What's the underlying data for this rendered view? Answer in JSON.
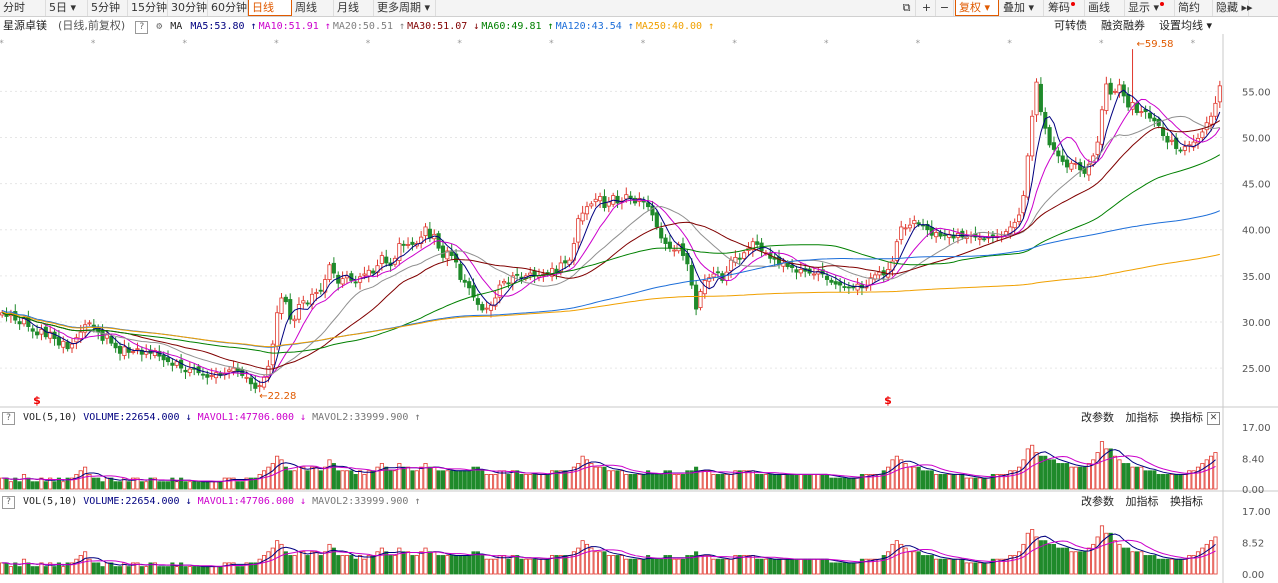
{
  "toolbar": {
    "items": [
      "分时",
      "5日",
      "5分钟",
      "15分钟",
      "30分钟",
      "60分钟",
      "日线",
      "周线",
      "月线",
      "更多周期"
    ],
    "right_items": [
      "复权",
      "叠加",
      "筹码",
      "画线",
      "显示",
      "简约",
      "隐藏"
    ]
  },
  "ma_line": {
    "stock_name": "星源卓镁",
    "mode": "(日线,前复权)",
    "ma_label": "MA",
    "items": [
      {
        "text": "MA5:53.80",
        "arrow": "↑",
        "color": "#000080"
      },
      {
        "text": "MA10:51.91",
        "arrow": "↑",
        "color": "#cc00cc"
      },
      {
        "text": "MA20:50.51",
        "arrow": "↑",
        "color": "#808080"
      },
      {
        "text": "MA30:51.07",
        "arrow": "↓",
        "color": "#800000"
      },
      {
        "text": "MA60:49.81",
        "arrow": "↑",
        "color": "#008000"
      },
      {
        "text": "MA120:43.54",
        "arrow": "↑",
        "color": "#1e6fd9"
      },
      {
        "text": "MA250:40.00",
        "arrow": "↑",
        "color": "#f0a000"
      }
    ],
    "right_links": [
      "可转债",
      "融资融券",
      "设置均线"
    ]
  },
  "volume_panes": [
    {
      "label": "VOL(5,10)",
      "volume": "VOLUME:22654.000",
      "vol_arrow": "↓",
      "mavol1": "MAVOL1:47706.000",
      "mavol1_arrow": "↓",
      "mavol2": "MAVOL2:33999.900",
      "mavol2_arrow": "↑",
      "links": [
        "改参数",
        "加指标",
        "换指标"
      ],
      "ticks": [
        "17.00",
        "8.40",
        "0.00"
      ]
    },
    {
      "label": "VOL(5,10)",
      "volume": "VOLUME:22654.000",
      "vol_arrow": "↓",
      "mavol1": "MAVOL1:47706.000",
      "mavol1_arrow": "↓",
      "mavol2": "MAVOL2:33999.900",
      "mavol2_arrow": "↑",
      "links": [
        "改参数",
        "加指标",
        "换指标"
      ],
      "ticks": [
        "17.00",
        "8.52",
        "0.00"
      ]
    }
  ],
  "close_glyph": "✕",
  "help_glyph": "?",
  "chart_data": {
    "type": "candlestick",
    "title": "",
    "y_ticks": [
      25,
      30,
      35,
      40,
      45,
      50,
      55
    ],
    "ylim": [
      21,
      61
    ],
    "annotations": [
      {
        "text": "22.28",
        "x": 58,
        "y": 22.28
      },
      {
        "text": "59.58",
        "x": 259,
        "y": 59.58
      }
    ],
    "markers": [
      {
        "text": "$",
        "x": 8
      },
      {
        "text": "$",
        "x": 203
      }
    ],
    "close": [
      31.0,
      30.6,
      30.9,
      30.2,
      29.8,
      30.4,
      29.5,
      29.0,
      28.6,
      29.2,
      28.4,
      28.9,
      28.2,
      27.5,
      27.9,
      27.1,
      27.6,
      28.3,
      28.9,
      29.7,
      29.9,
      29.4,
      28.9,
      28.0,
      28.6,
      27.7,
      27.2,
      26.6,
      27.3,
      26.7,
      26.8,
      27.1,
      26.5,
      26.8,
      26.6,
      26.9,
      26.3,
      25.9,
      25.7,
      25.3,
      25.7,
      25.0,
      24.6,
      24.9,
      24.9,
      24.5,
      24.3,
      24.0,
      24.2,
      24.5,
      24.2,
      24.4,
      24.8,
      25.0,
      24.7,
      24.2,
      24.0,
      23.3,
      22.8,
      23.1,
      24.0,
      25.2,
      27.6,
      31.0,
      32.6,
      32.2,
      30.3,
      30.3,
      31.9,
      32.3,
      32.0,
      33.0,
      33.2,
      33.4,
      34.6,
      36.2,
      35.3,
      34.2,
      34.7,
      35.0,
      34.5,
      34.3,
      34.9,
      35.2,
      35.6,
      35.3,
      36.1,
      37.2,
      36.4,
      36.1,
      36.9,
      38.5,
      38.3,
      38.4,
      38.4,
      38.5,
      39.2,
      40.3,
      39.1,
      39.5,
      38.0,
      37.0,
      37.7,
      37.2,
      36.5,
      34.6,
      34.3,
      33.7,
      32.7,
      31.9,
      31.3,
      31.5,
      31.8,
      32.6,
      34.0,
      34.4,
      34.2,
      35.0,
      35.1,
      34.8,
      35.0,
      35.3,
      35.0,
      35.0,
      35.2,
      35.2,
      35.8,
      35.4,
      36.4,
      36.4,
      36.7,
      38.5,
      41.2,
      41.8,
      42.5,
      42.8,
      43.3,
      43.6,
      42.4,
      43.0,
      43.7,
      42.9,
      43.1,
      43.8,
      43.4,
      42.9,
      43.4,
      43.0,
      42.5,
      41.6,
      40.3,
      39.1,
      38.5,
      38.0,
      37.8,
      38.4,
      37.2,
      36.3,
      34.0,
      31.4,
      33.3,
      34.5,
      34.8,
      35.2,
      35.4,
      34.5,
      35.4,
      36.7,
      37.0,
      36.8,
      37.5,
      38.0,
      38.7,
      38.4,
      37.7,
      37.5,
      36.9,
      36.8,
      36.2,
      36.4,
      36.0,
      35.9,
      35.4,
      35.7,
      35.5,
      35.3,
      35.2,
      35.5,
      35.2,
      34.6,
      34.3,
      34.1,
      34.0,
      33.8,
      33.7,
      33.7,
      34.1,
      33.7,
      33.8,
      34.8,
      35.1,
      35.4,
      35.1,
      35.7,
      36.6,
      38.7,
      40.3,
      40.2,
      40.5,
      41.0,
      40.6,
      40.5,
      40.0,
      39.4,
      39.7,
      39.3,
      39.4,
      39.5,
      39.1,
      39.6,
      39.2,
      39.3,
      39.4,
      39.2,
      39.1,
      39.0,
      39.2,
      39.3,
      39.3,
      39.3,
      39.8,
      40.3,
      40.8,
      41.6,
      43.7,
      48.0,
      52.3,
      56.0,
      52.8,
      51.0,
      49.2,
      48.7,
      48.0,
      47.4,
      46.8,
      47.2,
      47.2,
      46.5,
      46.1,
      47.1,
      48.0,
      49.5,
      53.0,
      55.8,
      54.7,
      55.0,
      55.7,
      54.5,
      53.3,
      53.8,
      52.7,
      52.8,
      52.8,
      52.1,
      51.8,
      51.3,
      50.2,
      49.5,
      49.7,
      48.8,
      48.6,
      49.0,
      49.2,
      49.5,
      49.9,
      50.6,
      51.6,
      52.3,
      53.7,
      55.6
    ],
    "volume": [
      3,
      3,
      2,
      3,
      2,
      4,
      3,
      2,
      2,
      3,
      2,
      3,
      2,
      3,
      2,
      3,
      3,
      4,
      5,
      6,
      4,
      3,
      3,
      2,
      3,
      3,
      2,
      2,
      3,
      2,
      3,
      3,
      2,
      2,
      3,
      3,
      2,
      2,
      2,
      3,
      2,
      3,
      2,
      2,
      2,
      2,
      2,
      2,
      2,
      2,
      2,
      3,
      3,
      3,
      2,
      2,
      3,
      3,
      3,
      4,
      5,
      6,
      7,
      9,
      8,
      6,
      5,
      5,
      6,
      6,
      5,
      6,
      6,
      5,
      6,
      8,
      7,
      5,
      5,
      5,
      5,
      4,
      5,
      4,
      5,
      5,
      6,
      7,
      6,
      5,
      5,
      7,
      6,
      6,
      5,
      5,
      6,
      7,
      6,
      6,
      5,
      5,
      5,
      5,
      5,
      5,
      5,
      5,
      6,
      6,
      5,
      4,
      4,
      4,
      5,
      5,
      4,
      5,
      5,
      4,
      4,
      4,
      4,
      4,
      4,
      4,
      5,
      5,
      5,
      5,
      5,
      6,
      7,
      9,
      8,
      7,
      6,
      6,
      6,
      5,
      5,
      5,
      5,
      4,
      4,
      4,
      4,
      4,
      5,
      4,
      4,
      4,
      5,
      5,
      4,
      4,
      4,
      5,
      5,
      6,
      5,
      5,
      5,
      4,
      4,
      4,
      4,
      4,
      5,
      5,
      5,
      5,
      5,
      4,
      4,
      4,
      4,
      4,
      4,
      4,
      4,
      4,
      4,
      4,
      4,
      4,
      4,
      4,
      4,
      4,
      3,
      3,
      3,
      3,
      3,
      3,
      3,
      4,
      4,
      4,
      4,
      4,
      5,
      6,
      8,
      9,
      8,
      7,
      6,
      6,
      6,
      5,
      5,
      5,
      4,
      4,
      4,
      4,
      4,
      4,
      4,
      3,
      3,
      3,
      3,
      3,
      3,
      4,
      4,
      4,
      4,
      5,
      5,
      6,
      8,
      11,
      12,
      10,
      9,
      9,
      8,
      8,
      7,
      7,
      7,
      6,
      6,
      6,
      6,
      7,
      8,
      10,
      13,
      11,
      11,
      9,
      8,
      7,
      7,
      6,
      6,
      6,
      5,
      5,
      5,
      4,
      4,
      4,
      4,
      4,
      4,
      4,
      5,
      5,
      6,
      7,
      8,
      9,
      10
    ]
  }
}
